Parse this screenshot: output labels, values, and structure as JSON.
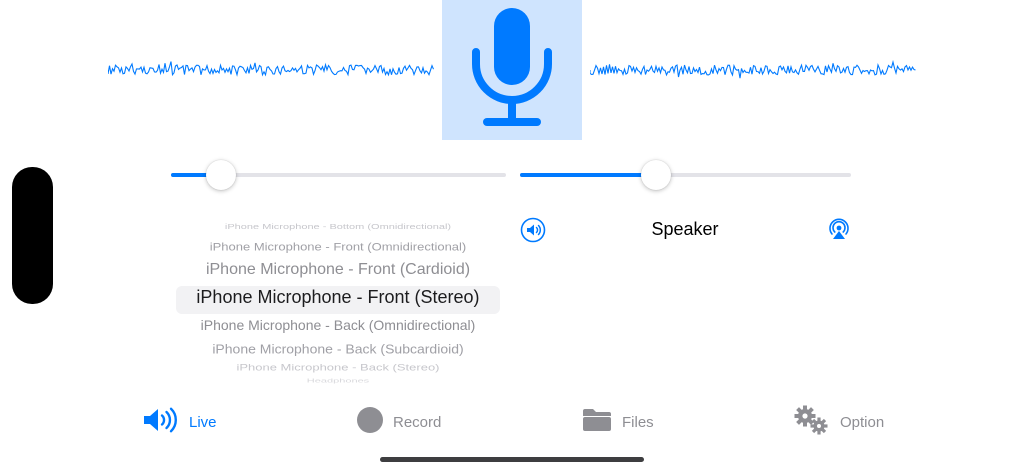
{
  "colors": {
    "accent": "#007aff",
    "inactive": "#8e8e93",
    "mic_tile_bg": "#cfe4fe"
  },
  "waveform": {
    "left_icon": "waveform",
    "right_icon": "waveform"
  },
  "mic": {
    "icon": "microphone-icon"
  },
  "sliders": {
    "input_gain": {
      "value": 0.15
    },
    "output_volume": {
      "value": 0.41
    }
  },
  "picker": {
    "selected_index": 3,
    "options": [
      "iPhone Microphone - Bottom (Omnidirectional)",
      "iPhone Microphone - Front (Omnidirectional)",
      "iPhone Microphone - Front (Cardioid)",
      "iPhone Microphone - Front (Stereo)",
      "iPhone Microphone - Back (Omnidirectional)",
      "iPhone Microphone - Back (Subcardioid)",
      "iPhone Microphone - Back (Stereo)",
      "Headphones"
    ]
  },
  "output": {
    "label": "Speaker",
    "volume_icon": "speaker-volume-icon",
    "airplay_icon": "airplay-icon"
  },
  "tabs": [
    {
      "label": "Live",
      "icon": "speaker-wave-icon",
      "active": true
    },
    {
      "label": "Record",
      "icon": "record-circle-icon",
      "active": false
    },
    {
      "label": "Files",
      "icon": "folder-icon",
      "active": false
    },
    {
      "label": "Option",
      "icon": "gears-icon",
      "active": false
    }
  ]
}
